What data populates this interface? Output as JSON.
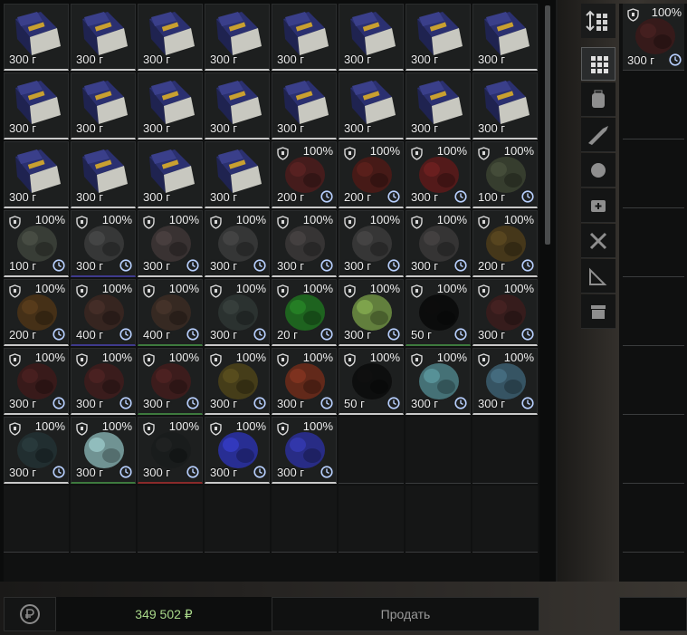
{
  "stash": {
    "items": [
      {
        "kind": "book",
        "price": "300 г"
      },
      {
        "kind": "book",
        "price": "300 г"
      },
      {
        "kind": "book",
        "price": "300 г"
      },
      {
        "kind": "book",
        "price": "300 г"
      },
      {
        "kind": "book",
        "price": "300 г"
      },
      {
        "kind": "book",
        "price": "300 г"
      },
      {
        "kind": "book",
        "price": "300 г"
      },
      {
        "kind": "book",
        "price": "300 г"
      },
      {
        "kind": "book",
        "price": "300 г"
      },
      {
        "kind": "book",
        "price": "300 г"
      },
      {
        "kind": "book",
        "price": "300 г"
      },
      {
        "kind": "book",
        "price": "300 г"
      },
      {
        "kind": "book",
        "price": "300 г"
      },
      {
        "kind": "book",
        "price": "300 г"
      },
      {
        "kind": "book",
        "price": "300 г"
      },
      {
        "kind": "book",
        "price": "300 г"
      },
      {
        "kind": "book",
        "price": "300 г"
      },
      {
        "kind": "book",
        "price": "300 г"
      },
      {
        "kind": "book",
        "price": "300 г"
      },
      {
        "kind": "book",
        "price": "300 г"
      },
      {
        "kind": "organic",
        "color": "#4a1c1c",
        "price": "200 г",
        "pct": "100%"
      },
      {
        "kind": "organic",
        "color": "#4b1a16",
        "price": "200 г",
        "pct": "100%"
      },
      {
        "kind": "organic",
        "color": "#5a1a1a",
        "price": "300 г",
        "pct": "100%"
      },
      {
        "kind": "organic",
        "color": "#3a4030",
        "price": "100 г",
        "pct": "100%"
      },
      {
        "kind": "organic",
        "color": "#3c4038",
        "price": "100 г",
        "pct": "100%"
      },
      {
        "kind": "organic",
        "color": "#3a3a3a",
        "price": "300 г",
        "pct": "100%",
        "tint": "purple"
      },
      {
        "kind": "organic",
        "color": "#3d3434",
        "price": "300 г",
        "pct": "100%"
      },
      {
        "kind": "organic",
        "color": "#383838",
        "price": "300 г",
        "pct": "100%"
      },
      {
        "kind": "organic",
        "color": "#3a3636",
        "price": "300 г",
        "pct": "100%"
      },
      {
        "kind": "organic",
        "color": "#3a3838",
        "price": "300 г",
        "pct": "100%"
      },
      {
        "kind": "organic",
        "color": "#383636",
        "price": "300 г",
        "pct": "100%"
      },
      {
        "kind": "organic",
        "color": "#4a3a1a",
        "price": "200 г",
        "pct": "100%"
      },
      {
        "kind": "organic",
        "color": "#4a3216",
        "price": "200 г",
        "pct": "100%"
      },
      {
        "kind": "organic",
        "color": "#3a2620",
        "price": "400 г",
        "pct": "100%",
        "tint": "purple"
      },
      {
        "kind": "organic",
        "color": "#3a2a22",
        "price": "400 г",
        "pct": "100%",
        "tint": "green"
      },
      {
        "kind": "organic",
        "color": "#2e3432",
        "price": "300 г",
        "pct": "100%"
      },
      {
        "kind": "organic",
        "color": "#1f6a1f",
        "price": "20 г",
        "pct": "100%"
      },
      {
        "kind": "organic",
        "color": "#6a8a40",
        "price": "300 г",
        "pct": "100%"
      },
      {
        "kind": "organic",
        "color": "#0a0a0a",
        "price": "50 г",
        "pct": "100%",
        "tint": "green"
      },
      {
        "kind": "organic",
        "color": "#3a1c1c",
        "price": "300 г",
        "pct": "100%"
      },
      {
        "kind": "organic",
        "color": "#3c1a1a",
        "price": "300 г",
        "pct": "100%"
      },
      {
        "kind": "organic",
        "color": "#3e1c1c",
        "price": "300 г",
        "pct": "100%"
      },
      {
        "kind": "organic",
        "color": "#401c1c",
        "price": "300 г",
        "pct": "100%",
        "tint": "green"
      },
      {
        "kind": "organic",
        "color": "#4a4018",
        "price": "300 г",
        "pct": "100%"
      },
      {
        "kind": "organic",
        "color": "#6a2a1a",
        "price": "300 г",
        "pct": "100%"
      },
      {
        "kind": "organic",
        "color": "#0c0c0c",
        "price": "50 г",
        "pct": "100%"
      },
      {
        "kind": "organic",
        "color": "#4a7a80",
        "price": "300 г",
        "pct": "100%"
      },
      {
        "kind": "organic",
        "color": "#3a5a6a",
        "price": "300 г",
        "pct": "100%"
      },
      {
        "kind": "organic",
        "color": "#223032",
        "price": "300 г",
        "pct": "100%"
      },
      {
        "kind": "organic",
        "color": "#7aa0a0",
        "price": "300 г",
        "pct": "100%",
        "tint": "green"
      },
      {
        "kind": "organic",
        "color": "#1a1c1c",
        "price": "300 г",
        "pct": "100%",
        "tint": "red"
      },
      {
        "kind": "organic",
        "color": "#2a30a0",
        "price": "300 г",
        "pct": "100%"
      },
      {
        "kind": "organic",
        "color": "#2a2e90",
        "price": "300 г",
        "pct": "100%"
      }
    ]
  },
  "filters": [
    {
      "icon": "grid-icon",
      "active": true
    },
    {
      "icon": "backpack-icon"
    },
    {
      "icon": "rifle-icon"
    },
    {
      "icon": "ball-icon"
    },
    {
      "icon": "medkit-icon"
    },
    {
      "icon": "tools-icon"
    },
    {
      "icon": "ruler-icon"
    },
    {
      "icon": "box-icon"
    }
  ],
  "seller_item": {
    "color": "#3a1a1a",
    "price": "300 г",
    "pct": "100%"
  },
  "bottom": {
    "total": "349 502 ₽",
    "sell_label": "Продать"
  },
  "colors": {
    "total": "#a9d98a",
    "sell": "#9a9a9a"
  }
}
